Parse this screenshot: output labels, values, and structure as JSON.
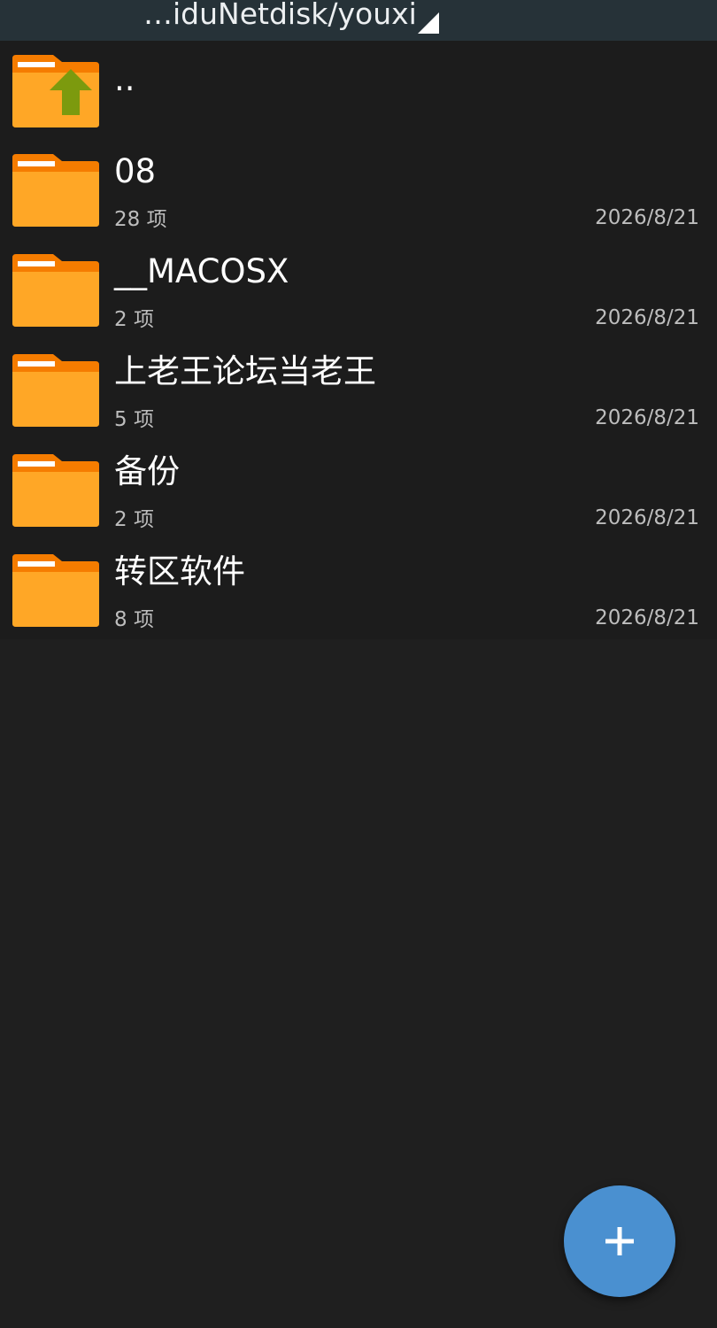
{
  "header": {
    "path": "…iduNetdisk/youxi"
  },
  "parent_entry": {
    "label": ".."
  },
  "folders": [
    {
      "name": "08",
      "count": "28 项",
      "date": "2026/8/21"
    },
    {
      "name": "__MACOSX",
      "count": "2 项",
      "date": "2026/8/21"
    },
    {
      "name": "上老王论坛当老王",
      "count": "5 项",
      "date": "2026/8/21"
    },
    {
      "name": "备份",
      "count": "2 项",
      "date": "2026/8/21"
    },
    {
      "name": "转区软件",
      "count": "8 项",
      "date": "2026/8/21"
    }
  ],
  "icons": {
    "folder": "folder-icon",
    "parent": "folder-up-icon",
    "dropdown": "dropdown-triangle-icon",
    "fab": "plus-icon"
  },
  "colors": {
    "folder": "#FFA726",
    "folder_dark": "#F57C00",
    "up_arrow": "#7C9A0E",
    "fab": "#4A90D0",
    "topbar": "#263238"
  }
}
